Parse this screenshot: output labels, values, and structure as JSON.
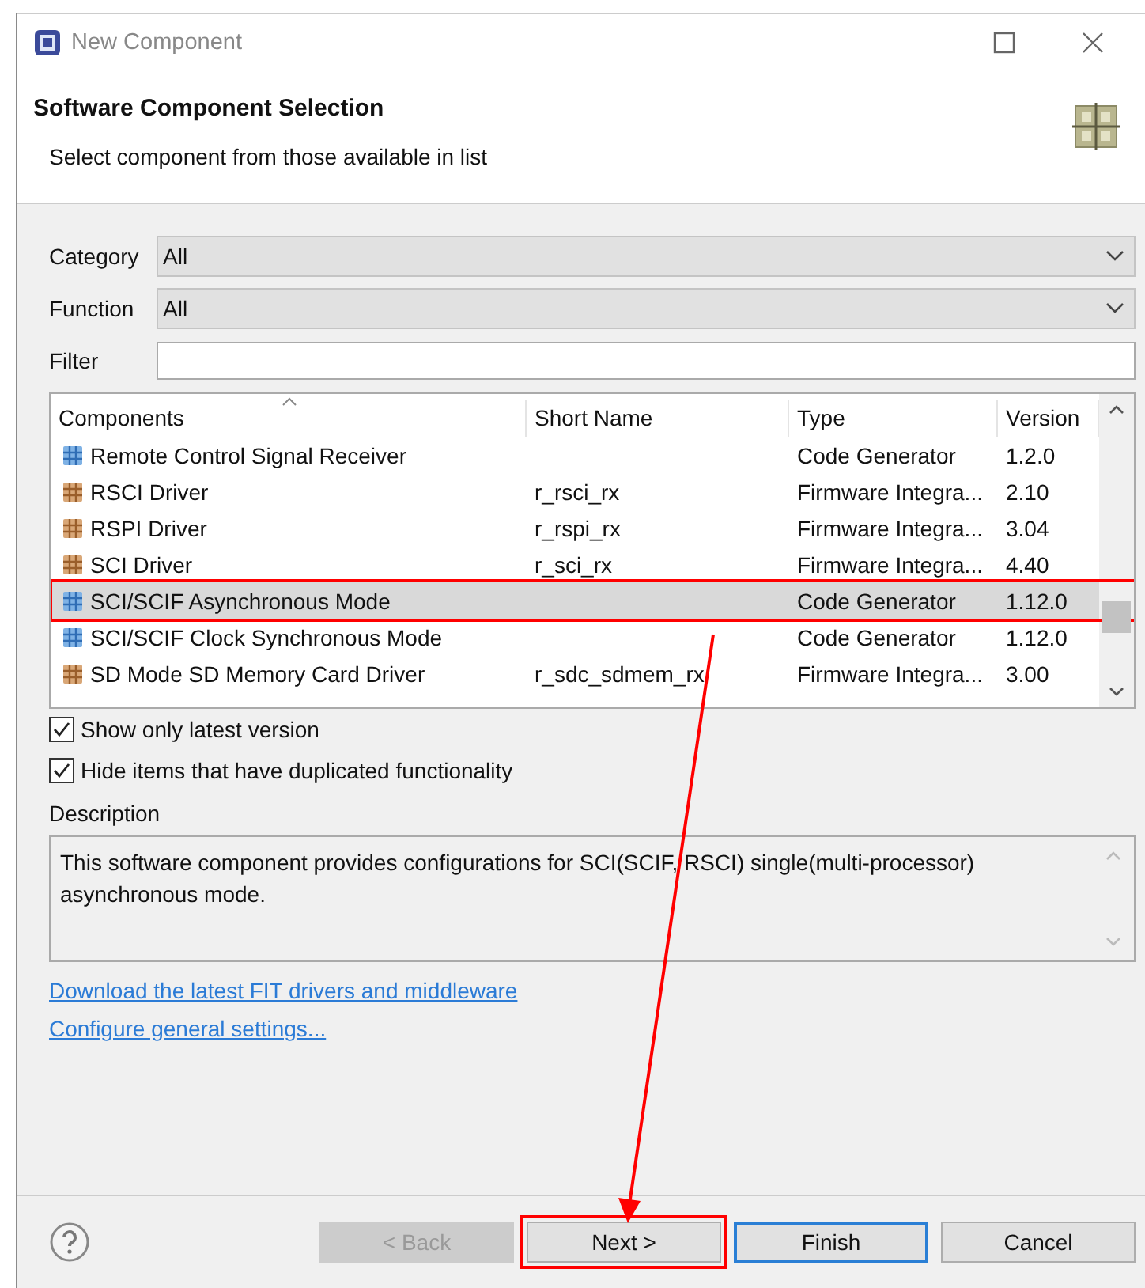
{
  "window": {
    "title": "New Component"
  },
  "header": {
    "title": "Software Component Selection",
    "subtitle": "Select component from those available in list"
  },
  "filters": [
    {
      "label": "Category",
      "kind": "dropdown",
      "value": "All"
    },
    {
      "label": "Function",
      "kind": "dropdown",
      "value": "All"
    },
    {
      "label": "Filter",
      "kind": "text"
    }
  ],
  "table": {
    "columns": [
      "Components",
      "Short Name",
      "Type",
      "Version"
    ],
    "rows": [
      {
        "kind": "generator",
        "selected": false,
        "highlighted": false,
        "cells": [
          "Remote Control Signal Receiver",
          "",
          "Code Generator",
          "1.2.0"
        ]
      },
      {
        "kind": "driver",
        "selected": false,
        "highlighted": false,
        "cells": [
          "RSCI Driver",
          "r_rsci_rx",
          "Firmware Integra...",
          "2.10"
        ]
      },
      {
        "kind": "driver",
        "selected": false,
        "highlighted": false,
        "cells": [
          "RSPI Driver",
          "r_rspi_rx",
          "Firmware Integra...",
          "3.04"
        ]
      },
      {
        "kind": "driver",
        "selected": false,
        "highlighted": false,
        "cells": [
          "SCI Driver",
          "r_sci_rx",
          "Firmware Integra...",
          "4.40"
        ]
      },
      {
        "kind": "generator",
        "selected": true,
        "highlighted": true,
        "cells": [
          "SCI/SCIF Asynchronous Mode",
          "",
          "Code Generator",
          "1.12.0"
        ]
      },
      {
        "kind": "generator",
        "selected": false,
        "highlighted": false,
        "cells": [
          "SCI/SCIF Clock Synchronous Mode",
          "",
          "Code Generator",
          "1.12.0"
        ]
      },
      {
        "kind": "driver",
        "selected": false,
        "highlighted": false,
        "cells": [
          "SD Mode SD Memory Card Driver",
          "r_sdc_sdmem_rx",
          "Firmware Integra...",
          "3.00"
        ]
      }
    ]
  },
  "options": [
    {
      "label": "Show only latest version",
      "checked": true
    },
    {
      "label": "Hide items that have duplicated functionality",
      "checked": true
    }
  ],
  "description": {
    "label": "Description",
    "text": "This software component provides configurations for SCI(SCIF, RSCI) single(multi-processor) asynchronous mode."
  },
  "links": [
    "Download the latest FIT drivers and middleware",
    "Configure general settings..."
  ],
  "buttons": [
    {
      "label": "< Back",
      "disabled": true,
      "default": false,
      "highlighted": false
    },
    {
      "label": "Next >",
      "disabled": false,
      "default": false,
      "highlighted": true
    },
    {
      "label": "Finish",
      "disabled": false,
      "default": true,
      "highlighted": false
    },
    {
      "label": "Cancel",
      "disabled": false,
      "default": false,
      "highlighted": false
    }
  ]
}
